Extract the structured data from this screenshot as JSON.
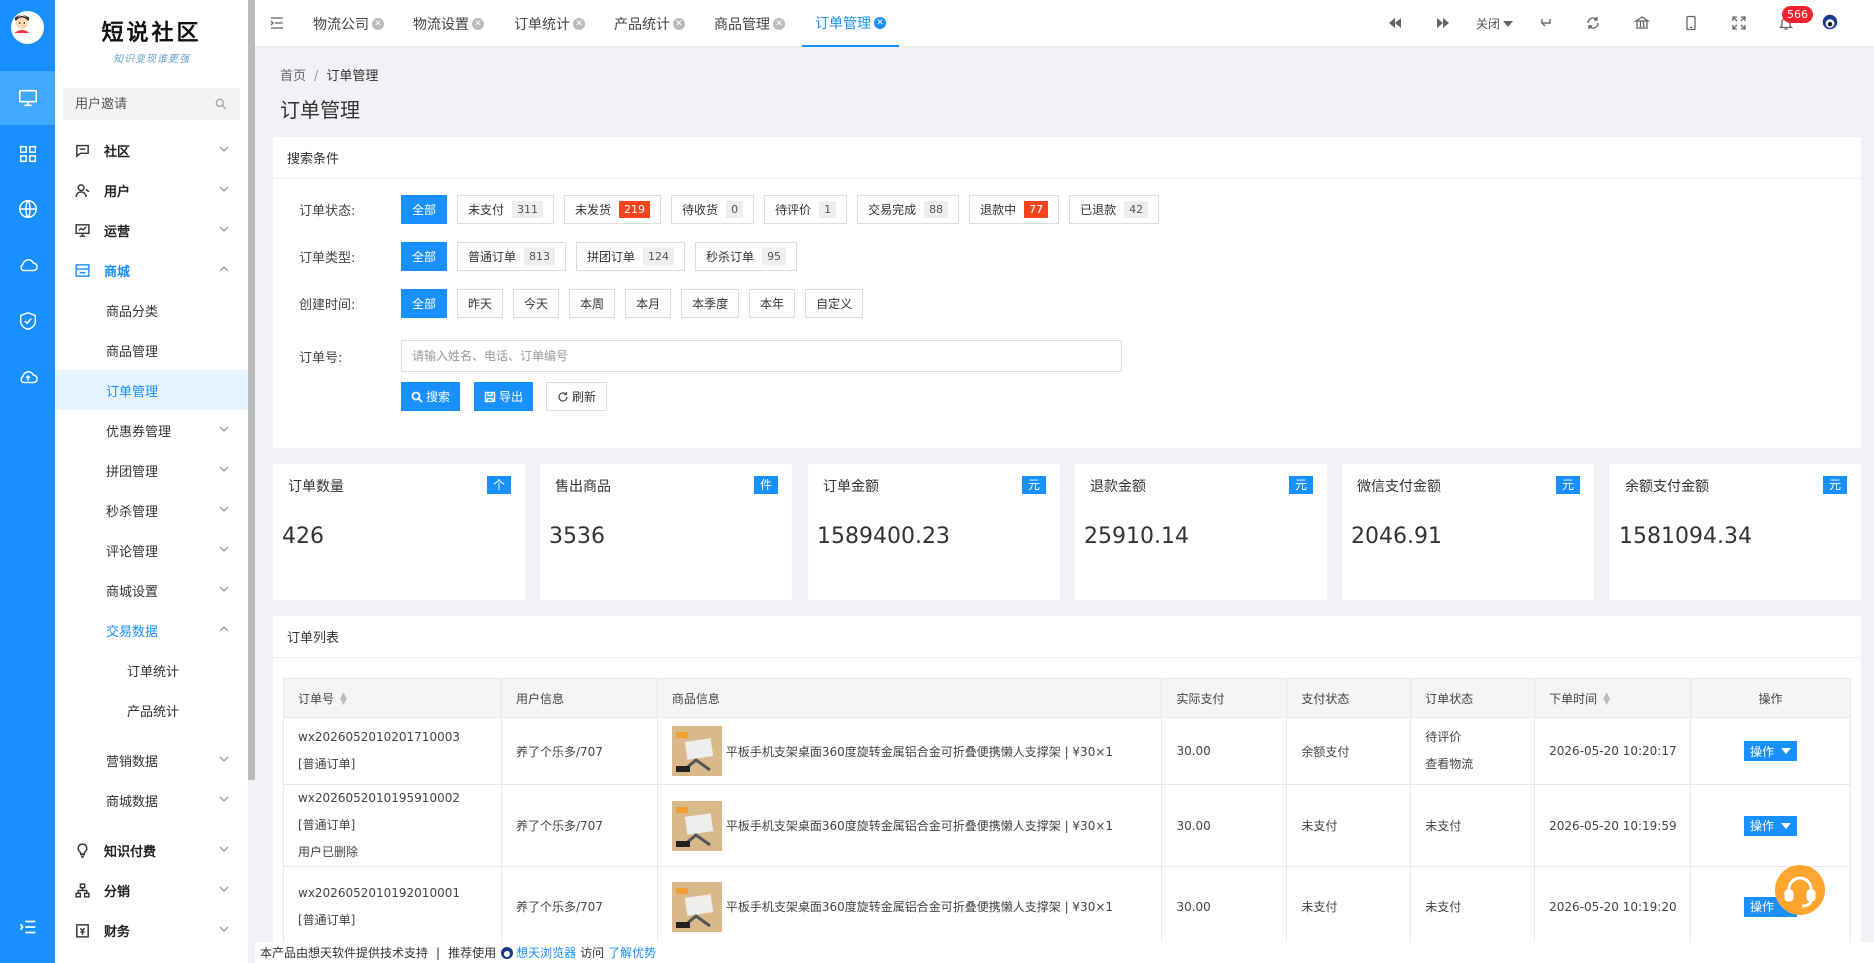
{
  "app": {
    "logo_title": "短说社区",
    "logo_slogan": "知识变现谁更强"
  },
  "colors": {
    "primary": "#1890ff",
    "danger": "#f5222d",
    "orange_badge": "#f5451f",
    "sidebar_selected_bg": "#e6f4ff"
  },
  "rail": {
    "icons": [
      "monitor-icon",
      "grid-icon",
      "globe-icon",
      "cloud-icon",
      "shield-check-icon",
      "cloud-upload-icon",
      "menu-fold-icon"
    ]
  },
  "sidebar": {
    "search_placeholder": "用户邀请",
    "items": [
      {
        "label": "社区",
        "level": 1,
        "icon": "chat-icon",
        "expanded": false
      },
      {
        "label": "用户",
        "level": 1,
        "icon": "user-icon",
        "expanded": false
      },
      {
        "label": "运营",
        "level": 1,
        "icon": "presentation-icon",
        "expanded": false
      },
      {
        "label": "商城",
        "level": 1,
        "icon": "shop-icon",
        "expanded": true
      },
      {
        "label": "商品分类",
        "level": 2
      },
      {
        "label": "商品管理",
        "level": 2
      },
      {
        "label": "订单管理",
        "level": 2,
        "selected": true
      },
      {
        "label": "优惠券管理",
        "level": 2,
        "expandable": true
      },
      {
        "label": "拼团管理",
        "level": 2,
        "expandable": true
      },
      {
        "label": "秒杀管理",
        "level": 2,
        "expandable": true
      },
      {
        "label": "评论管理",
        "level": 2,
        "expandable": true
      },
      {
        "label": "商城设置",
        "level": 2,
        "expandable": true
      },
      {
        "label": "交易数据",
        "level": 2,
        "expanded": true
      },
      {
        "label": "订单统计",
        "level": 3
      },
      {
        "label": "产品统计",
        "level": 3
      },
      {
        "label": "营销数据",
        "level": 2,
        "expandable": true
      },
      {
        "label": "商城数据",
        "level": 2,
        "expandable": true
      },
      {
        "label": "知识付费",
        "level": 1,
        "icon": "bulb-icon",
        "expanded": false
      },
      {
        "label": "分销",
        "level": 1,
        "icon": "network-icon",
        "expanded": false
      },
      {
        "label": "财务",
        "level": 1,
        "icon": "finance-icon",
        "expanded": false
      }
    ]
  },
  "tabs": [
    {
      "label": "物流公司"
    },
    {
      "label": "物流设置"
    },
    {
      "label": "订单统计"
    },
    {
      "label": "产品统计"
    },
    {
      "label": "商品管理"
    },
    {
      "label": "订单管理",
      "active": true
    }
  ],
  "toolbar": {
    "close_label": "关闭",
    "notification_count": "566"
  },
  "breadcrumb": {
    "home": "首页",
    "separator": "/",
    "current": "订单管理"
  },
  "page_title": "订单管理",
  "search": {
    "title": "搜索条件",
    "status_label": "订单状态:",
    "status_options": [
      {
        "label": "全部",
        "active": true
      },
      {
        "label": "未支付",
        "count": "311"
      },
      {
        "label": "未发货",
        "count": "219",
        "highlight": true
      },
      {
        "label": "待收货",
        "count": "0"
      },
      {
        "label": "待评价",
        "count": "1"
      },
      {
        "label": "交易完成",
        "count": "88"
      },
      {
        "label": "退款中",
        "count": "77",
        "highlight": true
      },
      {
        "label": "已退款",
        "count": "42"
      }
    ],
    "type_label": "订单类型:",
    "type_options": [
      {
        "label": "全部",
        "active": true
      },
      {
        "label": "普通订单",
        "count": "813"
      },
      {
        "label": "拼团订单",
        "count": "124"
      },
      {
        "label": "秒杀订单",
        "count": "95"
      }
    ],
    "time_label": "创建时间:",
    "time_options": [
      {
        "label": "全部",
        "active": true
      },
      {
        "label": "昨天"
      },
      {
        "label": "今天"
      },
      {
        "label": "本周"
      },
      {
        "label": "本月"
      },
      {
        "label": "本季度"
      },
      {
        "label": "本年"
      },
      {
        "label": "自定义"
      }
    ],
    "order_no_label": "订单号:",
    "order_no_placeholder": "请输入姓名、电话、订单编号",
    "search_button": "搜索",
    "export_button": "导出",
    "refresh_button": "刷新"
  },
  "stats": [
    {
      "title": "订单数量",
      "unit": "个",
      "value": "426"
    },
    {
      "title": "售出商品",
      "unit": "件",
      "value": "3536"
    },
    {
      "title": "订单金额",
      "unit": "元",
      "value": "1589400.23"
    },
    {
      "title": "退款金额",
      "unit": "元",
      "value": "25910.14"
    },
    {
      "title": "微信支付金额",
      "unit": "元",
      "value": "2046.91"
    },
    {
      "title": "余额支付金额",
      "unit": "元",
      "value": "1581094.34"
    }
  ],
  "order_list": {
    "title": "订单列表",
    "columns": [
      "订单号",
      "用户信息",
      "商品信息",
      "实际支付",
      "支付状态",
      "订单状态",
      "下单时间",
      "操作"
    ],
    "rows": [
      {
        "order_no": "wx2026052010201710003",
        "type": "[普通订单]",
        "note": "",
        "user": "养了个乐多/707",
        "product": "平板手机支架桌面360度旋转金属铝合金可折叠便携懒人支撑架 | ¥30×1",
        "paid": "30.00",
        "pay_status": "余额支付",
        "order_status": "待评价",
        "order_status_2": "查看物流",
        "time": "2026-05-20 10:20:17",
        "action": "操作"
      },
      {
        "order_no": "wx2026052010195910002",
        "type": "[普通订单]",
        "note": "用户已删除",
        "user": "养了个乐多/707",
        "product": "平板手机支架桌面360度旋转金属铝合金可折叠便携懒人支撑架 | ¥30×1",
        "paid": "30.00",
        "pay_status": "未支付",
        "order_status": "未支付",
        "order_status_2": "",
        "time": "2026-05-20 10:19:59",
        "action": "操作"
      },
      {
        "order_no": "wx2026052010192010001",
        "type": "[普通订单]",
        "note": "",
        "user": "养了个乐多/707",
        "product": "平板手机支架桌面360度旋转金属铝合金可折叠便携懒人支撑架 | ¥30×1",
        "paid": "30.00",
        "pay_status": "未支付",
        "order_status": "未支付",
        "order_status_2": "",
        "time": "2026-05-20 10:19:20",
        "action": "操作"
      }
    ]
  },
  "footer": {
    "text1": "本产品由想天软件提供技术支持",
    "sep": "|",
    "text2": "推荐使用",
    "browser": "想天浏览器",
    "text3": "访问",
    "link": "了解优势"
  }
}
